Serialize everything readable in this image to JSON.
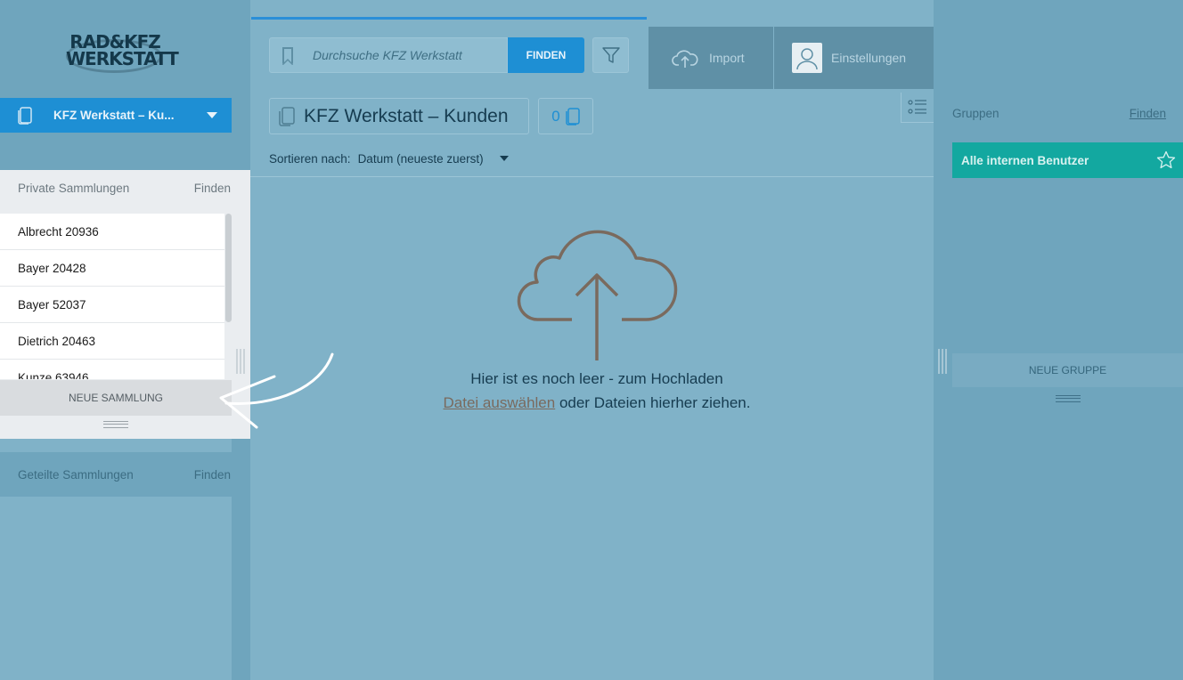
{
  "logo": {
    "line1": "RAD&KFZ",
    "line2": "WERKSTATT"
  },
  "collection_select": {
    "label": "KFZ Werkstatt – Ku..."
  },
  "private": {
    "header": "Private Sammlungen",
    "find": "Finden",
    "items": [
      "Albrecht 20936",
      "Bayer 20428",
      "Bayer 52037",
      "Dietrich 20463",
      "Kunze 63946"
    ],
    "new_label": "NEUE SAMMLUNG"
  },
  "shared": {
    "header": "Geteilte Sammlungen",
    "find": "Finden"
  },
  "search": {
    "placeholder": "Durchsuche KFZ Werkstatt",
    "button": "FINDEN"
  },
  "toolbar": {
    "import_label": "Import",
    "settings_label": "Einstellungen"
  },
  "collection": {
    "title": "KFZ Werkstatt – Kunden",
    "count": "0"
  },
  "sort": {
    "label": "Sortieren nach:",
    "value": "Datum (neueste zuerst)"
  },
  "empty": {
    "line1": "Hier ist es noch leer - zum Hochladen",
    "link": "Datei auswählen",
    "line2_rest": " oder Dateien hierher ziehen."
  },
  "groups": {
    "header": "Gruppen",
    "find": "Finden",
    "active": "Alle internen Benutzer",
    "new_label": "NEUE GRUPPE"
  },
  "colors": {
    "accent": "#1e8fd4",
    "teal": "#13a8a0",
    "upload_icon": "#7a6a5e"
  }
}
